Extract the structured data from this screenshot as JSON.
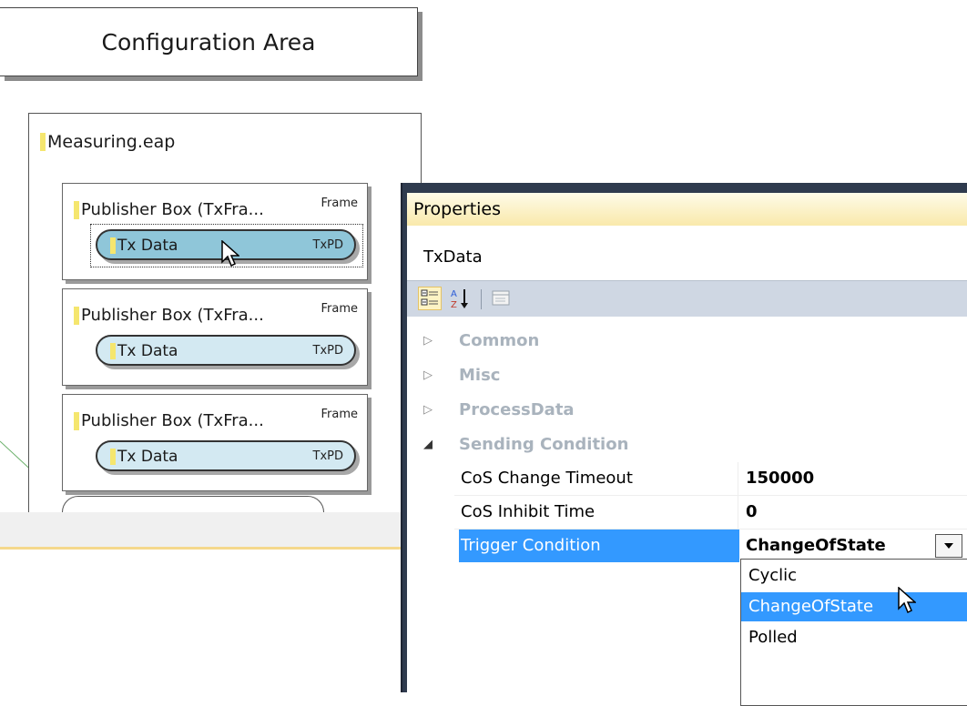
{
  "config_area": {
    "title": "Configuration Area",
    "eap": {
      "filename": "Measuring.eap",
      "publisher_boxes": [
        {
          "title": "Publisher Box (TxFra...",
          "frame_label": "Frame",
          "pill_label": "Tx Data",
          "pill_type": "TxPD"
        },
        {
          "title": "Publisher Box (TxFra...",
          "frame_label": "Frame",
          "pill_label": "Tx Data",
          "pill_type": "TxPD"
        },
        {
          "title": "Publisher Box (TxFra...",
          "frame_label": "Frame",
          "pill_label": "Tx Data",
          "pill_type": "TxPD"
        }
      ]
    }
  },
  "properties": {
    "title": "Properties",
    "object_name": "TxData",
    "toolbar": {
      "categorized_icon": "categorized-icon",
      "alphabetical_icon": "alphabetical-sort-icon",
      "property_pages_icon": "property-pages-icon"
    },
    "categories": [
      {
        "label": "Common",
        "expanded": false
      },
      {
        "label": "Misc",
        "expanded": false
      },
      {
        "label": "ProcessData",
        "expanded": false
      },
      {
        "label": "Sending Condition",
        "expanded": true
      }
    ],
    "rows": [
      {
        "name": "CoS Change Timeout",
        "value": "150000"
      },
      {
        "name": "CoS Inhibit Time",
        "value": "0"
      },
      {
        "name": "Trigger Condition",
        "value": "ChangeOfState",
        "selected": true
      }
    ],
    "dropdown": {
      "options": [
        "Cyclic",
        "ChangeOfState",
        "Polled"
      ],
      "highlighted": "ChangeOfState"
    }
  },
  "colors": {
    "selection": "#3399ff",
    "pill_selected": "#8fc6d9",
    "pill": "#d3e9f2",
    "panel_title": "#f9e9ab"
  }
}
